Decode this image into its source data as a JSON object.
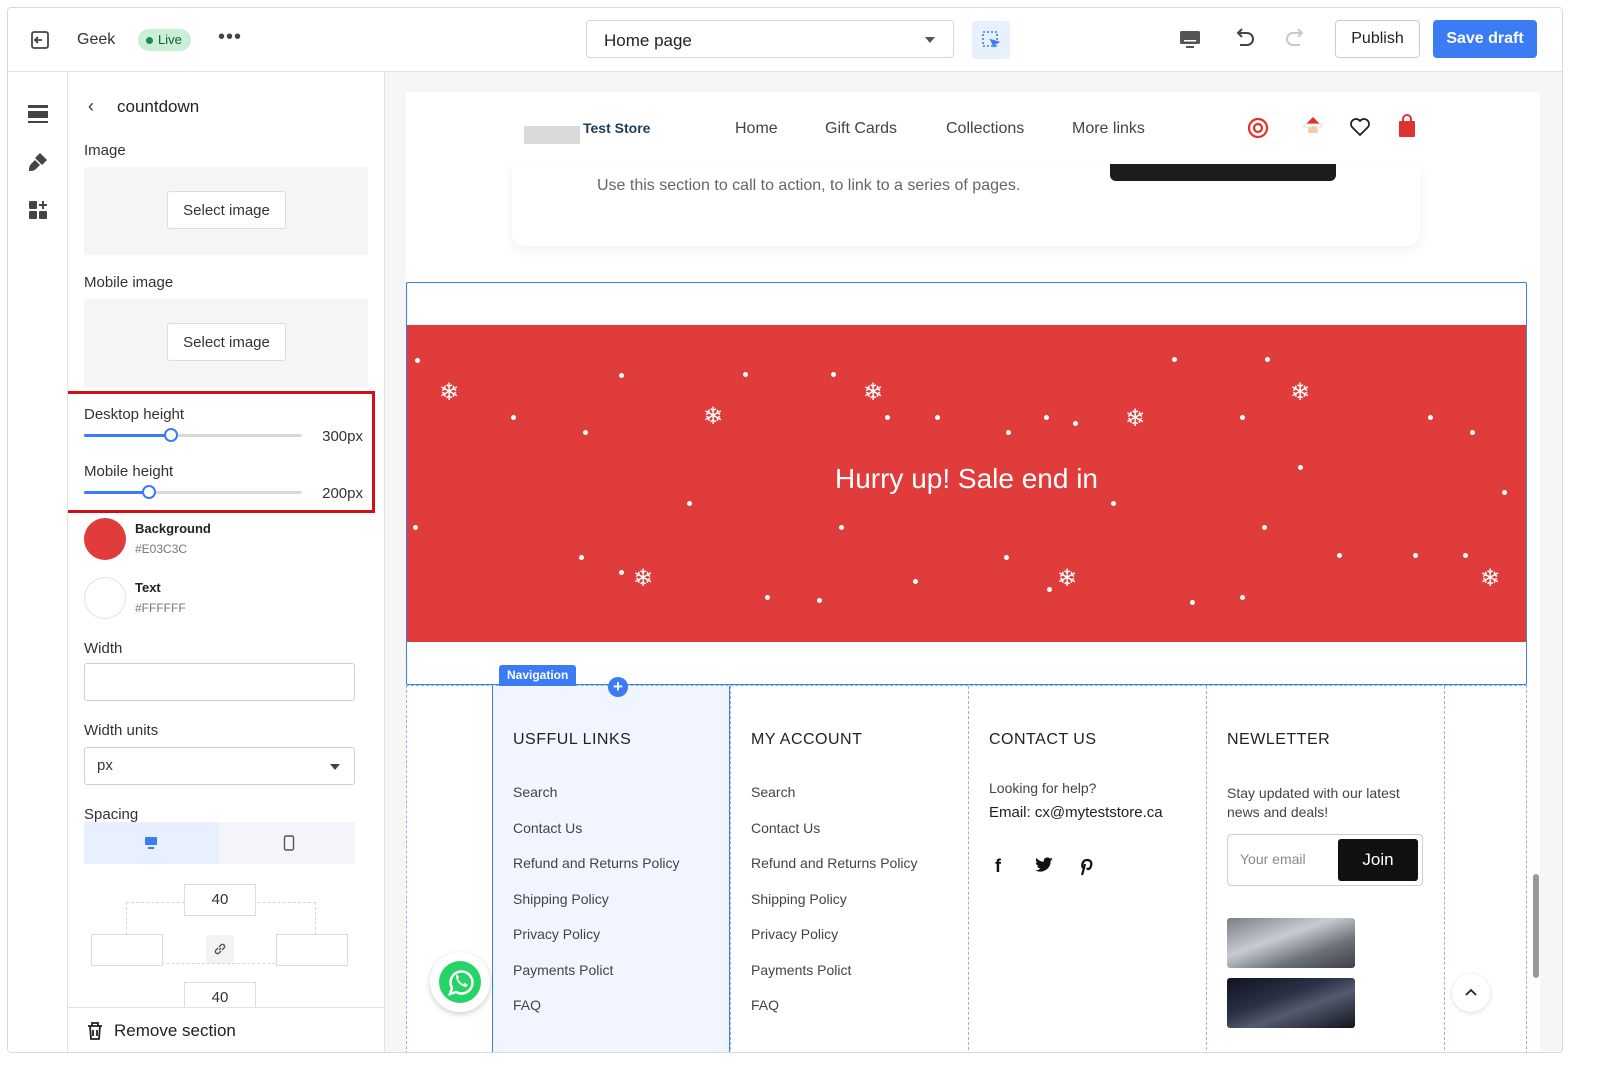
{
  "topbar": {
    "store_name": "Geek",
    "live_badge": "Live",
    "more": "•••",
    "page_select": "Home page",
    "publish_label": "Publish",
    "save_label": "Save draft"
  },
  "panel": {
    "title": "countdown",
    "image_label": "Image",
    "select_image": "Select image",
    "mobile_image_label": "Mobile image",
    "desktop_height_label": "Desktop height",
    "desktop_height_value": "300px",
    "desktop_height_fraction": 0.4,
    "mobile_height_label": "Mobile height",
    "mobile_height_value": "200px",
    "mobile_height_fraction": 0.3,
    "background_label": "Background",
    "background_hex": "#E03C3C",
    "text_label": "Text",
    "text_hex": "#FFFFFF",
    "width_label": "Width",
    "width_value": "",
    "width_units_label": "Width units",
    "width_units_value": "px",
    "spacing_label": "Spacing",
    "spacing_top": "40",
    "spacing_bottom": "40",
    "spacing_left": "",
    "spacing_right": "",
    "remove_section": "Remove section"
  },
  "preview": {
    "store_name": "Test Store",
    "nav": [
      "Home",
      "Gift Cards",
      "Collections",
      "More links"
    ],
    "cta_text": "Use this section to call to action, to link to a series of pages.",
    "banner_text": "Hurry up! Sale end in",
    "banner_color": "#E03C3C",
    "navigation_tag": "Navigation",
    "footer": {
      "col1": {
        "heading": "USFFUL LINKS",
        "links": [
          "Search",
          "Contact Us",
          "Refund and Returns Policy",
          "Shipping Policy",
          "Privacy Policy",
          "Payments Polict",
          "FAQ"
        ]
      },
      "col2": {
        "heading": "MY ACCOUNT",
        "links": [
          "Search",
          "Contact Us",
          "Refund and Returns Policy",
          "Shipping Policy",
          "Privacy Policy",
          "Payments Polict",
          "FAQ"
        ]
      },
      "col3": {
        "heading": "CONTACT US",
        "help": "Looking for help?",
        "email": "Email:  cx@myteststore.ca"
      },
      "col4": {
        "heading": "NEWLETTER",
        "text": "Stay updated with our latest news and deals!",
        "email_placeholder": "Your email",
        "join": "Join"
      }
    }
  },
  "colors": {
    "accent": "#3B7CF4",
    "highlight": "#D20F14"
  }
}
